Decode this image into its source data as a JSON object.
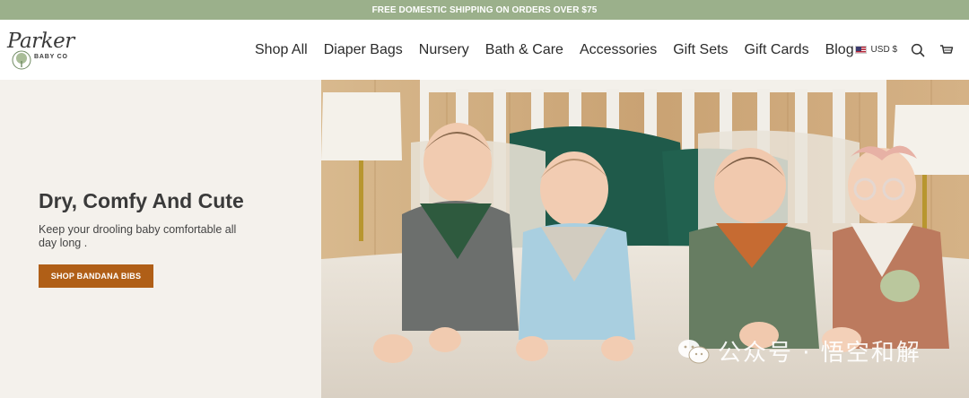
{
  "announcement": {
    "text": "FREE DOMESTIC SHIPPING ON ORDERS OVER $75"
  },
  "logo": {
    "script": "Parker",
    "sub": "BABY CO"
  },
  "nav": [
    {
      "label": "Shop All"
    },
    {
      "label": "Diaper Bags"
    },
    {
      "label": "Nursery"
    },
    {
      "label": "Bath & Care"
    },
    {
      "label": "Accessories"
    },
    {
      "label": "Gift Sets"
    },
    {
      "label": "Gift Cards"
    },
    {
      "label": "Blog"
    }
  ],
  "utility": {
    "currency": "USD $",
    "icons": [
      "us-flag-icon",
      "search-icon",
      "cart-icon"
    ]
  },
  "hero": {
    "title": "Dry, Comfy And Cute",
    "text": "Keep your drooling baby comfortable all day long .",
    "button": "SHOP BANDANA BIBS",
    "button_color": "#b05f17",
    "bg_color": "#f4f1ec"
  },
  "watermark": {
    "text": "公众号 · 悟空和解",
    "icon": "wechat-icon"
  },
  "colors": {
    "announcement_bg": "#9bb08b",
    "accent": "#b05f17"
  }
}
